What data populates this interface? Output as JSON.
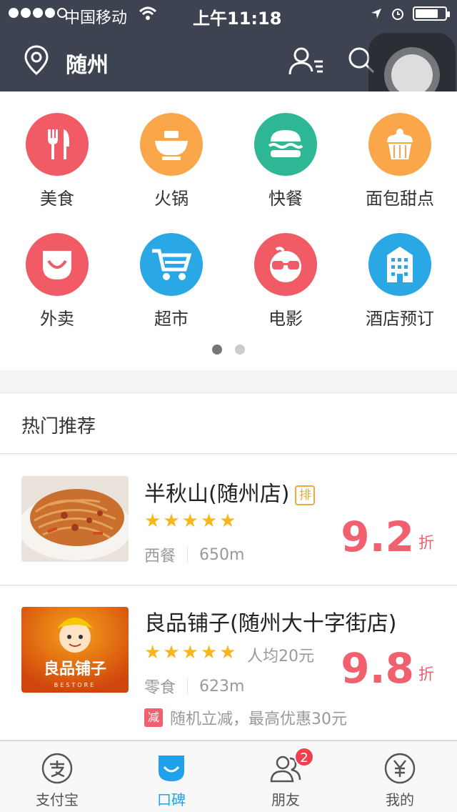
{
  "status_bar": {
    "carrier": "中国移动",
    "time": "上午11:18"
  },
  "header": {
    "city": "随州"
  },
  "categories": [
    {
      "label": "美食",
      "color": "#f15b65",
      "icon": "fork-knife-icon"
    },
    {
      "label": "火锅",
      "color": "#f9a74a",
      "icon": "hotpot-icon"
    },
    {
      "label": "快餐",
      "color": "#2db794",
      "icon": "burger-icon"
    },
    {
      "label": "面包甜点",
      "color": "#f9a74a",
      "icon": "cupcake-icon"
    },
    {
      "label": "外卖",
      "color": "#f15b65",
      "icon": "smile-bag-icon"
    },
    {
      "label": "超市",
      "color": "#2aa8e6",
      "icon": "cart-icon"
    },
    {
      "label": "电影",
      "color": "#f15b65",
      "icon": "glasses-face-icon"
    },
    {
      "label": "酒店预订",
      "color": "#2aa8e6",
      "icon": "building-icon"
    }
  ],
  "section": {
    "title": "热门推荐"
  },
  "items": [
    {
      "name": "半秋山(随州店)",
      "rank_badge": "排",
      "stars": 5,
      "avg_price": "",
      "category": "西餐",
      "distance": "650m",
      "discount": "9.2",
      "discount_unit": "折",
      "promo_tag": "",
      "promo_text": ""
    },
    {
      "name": "良品铺子(随州大十字街店)",
      "rank_badge": "",
      "stars": 5,
      "avg_price": "人均20元",
      "category": "零食",
      "distance": "623m",
      "discount": "9.8",
      "discount_unit": "折",
      "promo_tag": "减",
      "promo_text": "随机立减，最高优惠30元",
      "logo_text": "良品铺子"
    }
  ],
  "tabbar": [
    {
      "label": "支付宝",
      "icon": "alipay-icon",
      "active": false
    },
    {
      "label": "口碑",
      "icon": "koubei-icon",
      "active": true
    },
    {
      "label": "朋友",
      "icon": "friends-icon",
      "active": false,
      "badge": "2"
    },
    {
      "label": "我的",
      "icon": "yuan-icon",
      "active": false
    }
  ]
}
